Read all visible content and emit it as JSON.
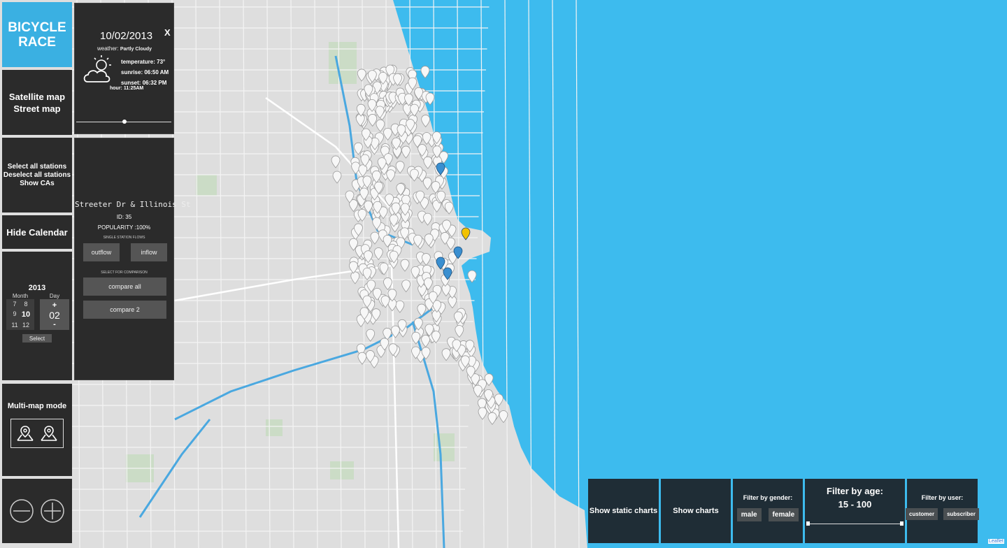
{
  "app": {
    "logo_line1": "BICYCLE",
    "logo_line2": "RACE",
    "attribution": "Leaflet"
  },
  "sidebar": {
    "map_type": [
      "Satellite map",
      "Street map"
    ],
    "station_actions": [
      "Select all stations",
      "Deselect all stations",
      "Show CAs"
    ],
    "hide_calendar": "Hide Calendar",
    "multimap_label": "Multi-map mode"
  },
  "calendar": {
    "year": "2013",
    "month_label": "Month",
    "day_label": "Day",
    "months": [
      "7",
      "8",
      "9",
      "10",
      "11",
      "12"
    ],
    "selected_month": "10",
    "day_plus": "+",
    "day_value": "02",
    "day_minus": "-",
    "select_label": "Select"
  },
  "weather_panel": {
    "date": "10/02/2013",
    "close_label": "X",
    "weather_label": "weather:",
    "weather_value": "Partly Cloudy",
    "temperature_label": "temperature:",
    "temperature_value": "73°",
    "sunrise_label": "sunrise:",
    "sunrise_value": "06:50 AM",
    "sunset_label": "sunset:",
    "sunset_value": "06:32 PM",
    "hour_label": "hour:",
    "hour_value": "11:25AM",
    "icon": "partly-cloudy-icon"
  },
  "station_panel": {
    "name": "Streeter Dr & Illinois St",
    "id_label": "ID:",
    "id_value": "35",
    "popularity_label": "POPULARITY :",
    "popularity_value": "100%",
    "flows_heading": "SINGLE STATION FLOWS",
    "outflow_label": "outflow",
    "inflow_label": "inflow",
    "comparison_heading": "SELECT FOR COMPARISON",
    "compare_all_label": "compare all",
    "compare_2_label": "compare 2"
  },
  "bottom_bar": {
    "static_charts_label": "Show static charts",
    "charts_label": "Show charts",
    "gender_heading": "Filter by gender:",
    "gender_options": [
      "male",
      "female"
    ],
    "age_heading": "Filter by age:",
    "age_range": "15 - 100",
    "user_heading": "Filter by user:",
    "user_options": [
      "customer",
      "subscriber"
    ]
  },
  "colors": {
    "lake": "#3dbbee",
    "land": "#dcdcdc",
    "panel": "#2b2b2b",
    "bottom_panel": "#1f2d36",
    "accent_marker": "#3a8fd0",
    "logo": "#3ab0e2"
  }
}
